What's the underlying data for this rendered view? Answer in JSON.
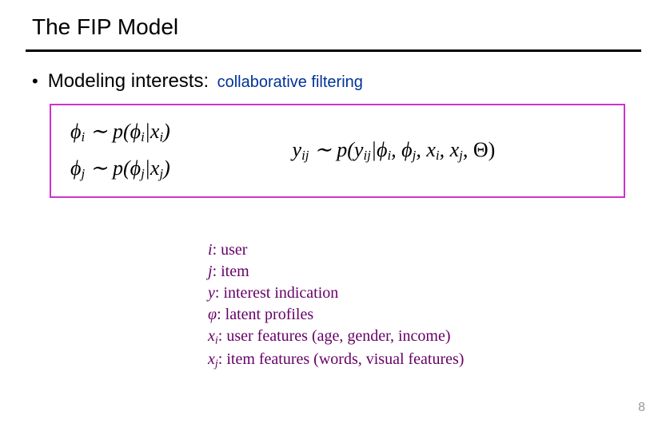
{
  "title": "The FIP Model",
  "bullet": {
    "dot": "•",
    "main": "Modeling interests:",
    "sub": "collaborative filtering"
  },
  "equations": {
    "phi_i_lhs": "ϕ",
    "phi_i_lhs_sub": "i",
    "phi_i_dist": " ∼ p(ϕ",
    "phi_i_dist_sub": "i",
    "phi_i_given": "|x",
    "phi_i_given_sub": "i",
    "phi_i_close": ")",
    "phi_j_lhs": "ϕ",
    "phi_j_lhs_sub": "j",
    "phi_j_dist": " ∼ p(ϕ",
    "phi_j_dist_sub": "j",
    "phi_j_given": "|x",
    "phi_j_given_sub": "j",
    "phi_j_close": ")",
    "y_lhs": "y",
    "y_lhs_sub": "ij",
    "y_dist": " ∼ p(y",
    "y_dist_sub": "ij",
    "y_given_a": "|ϕ",
    "y_given_a_sub": "i",
    "y_given_b": ", ϕ",
    "y_given_b_sub": "j",
    "y_given_c": ", x",
    "y_given_c_sub": "i",
    "y_given_d": ", x",
    "y_given_d_sub": "j",
    "y_theta": ", Θ)"
  },
  "legend": {
    "i_sym": "i",
    "i_def": ": user",
    "j_sym": "j",
    "j_def": ": item",
    "y_sym": "y",
    "y_def": ": interest indication",
    "phi_sym": "φ",
    "phi_def": ": latent profiles",
    "xi_sym": "x",
    "xi_sub": "i",
    "xi_def": ": user features (age, gender, income)",
    "xj_sym": "x",
    "xj_sub": "j",
    "xj_def": ": item features (words, visual features)"
  },
  "pagenum": "8"
}
